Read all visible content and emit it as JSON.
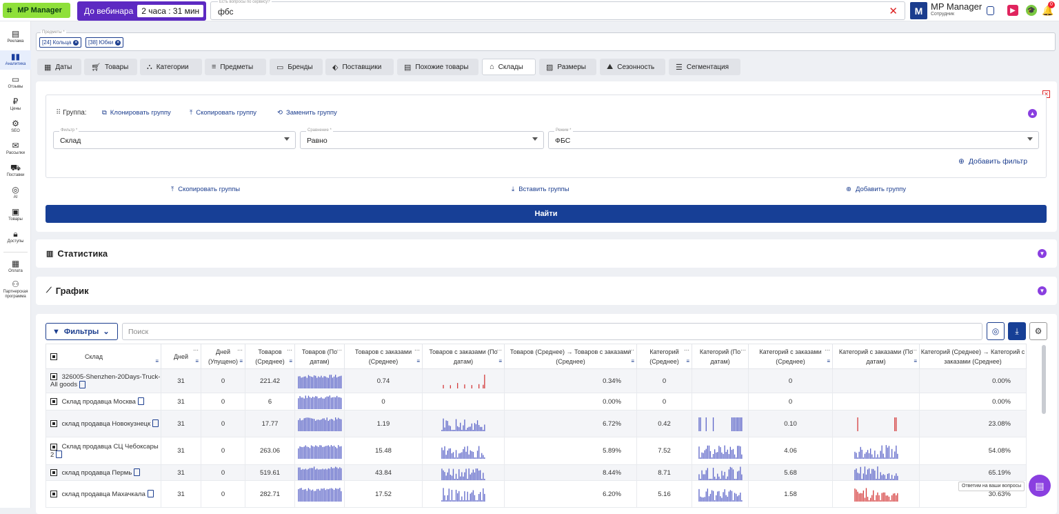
{
  "header": {
    "logo": "MP Manager",
    "webinar_label": "До вебинара",
    "webinar_timer": "2 часа : 31 мин",
    "search_label": "Есть вопросы по сервису?",
    "search_value": "фбс",
    "avatar_letter": "M",
    "user_name": "MP Manager",
    "user_role": "Сотрудник",
    "notif_count": "0"
  },
  "sidebar": [
    {
      "label": "Реклама",
      "icon": "ad-icon"
    },
    {
      "label": "Аналитика",
      "icon": "chart-icon"
    },
    {
      "label": "Отзывы",
      "icon": "chat-icon"
    },
    {
      "label": "Цены",
      "icon": "ruble-icon"
    },
    {
      "label": "SEO",
      "icon": "seo-icon"
    },
    {
      "label": "Рассылки",
      "icon": "mail-icon"
    },
    {
      "label": "Поставки",
      "icon": "truck-icon"
    },
    {
      "label": "AI",
      "icon": "ai-icon"
    },
    {
      "label": "Товары",
      "icon": "box-icon"
    },
    {
      "label": "Доступы",
      "icon": "lock-icon"
    },
    {
      "label": "Оплата",
      "icon": "wallet-icon"
    },
    {
      "label": "Партнерская программа",
      "icon": "partners-icon"
    }
  ],
  "predmety": {
    "label": "Предметы *",
    "chips": [
      "[24] Кольца",
      "[38] Юбки"
    ]
  },
  "tabs": [
    "Даты",
    "Товары",
    "Категории",
    "Предметы",
    "Бренды",
    "Поставщики",
    "Похожие товары",
    "Склады",
    "Размеры",
    "Сезонность",
    "Сегментация"
  ],
  "active_tab": "Склады",
  "filter": {
    "group_label": "Группа:",
    "clone": "Клонировать группу",
    "copy": "Скопировать группу",
    "replace": "Заменить группу",
    "f1_label": "Фильтр *",
    "f1_value": "Склад",
    "f2_label": "Сравнение *",
    "f2_value": "Равно",
    "f3_label": "Режим *",
    "f3_value": "ФБС",
    "add_filter": "Добавить фильтр",
    "copy_groups": "Скопировать группы",
    "paste_groups": "Вставить группы",
    "add_group": "Добавить группу",
    "find": "Найти"
  },
  "sections": {
    "stats": "Статистика",
    "chart": "График"
  },
  "toolbar": {
    "filters": "Фильтры",
    "search_placeholder": "Поиск"
  },
  "table": {
    "headers": [
      "Склад",
      "Дней",
      "Дней (Упущено)",
      "Товаров (Среднее)",
      "Товаров (По датам)",
      "Товаров с заказами (Среднее)",
      "Товаров с заказами (По датам)",
      "Товаров (Среднее) → Товаров с заказами (Среднее)",
      "Категорий (Среднее)",
      "Категорий (По датам)",
      "Категорий с заказами (Среднее)",
      "Категорий с заказами (По датам)",
      "Категорий (Среднее) → Категорий с заказами (Среднее)"
    ],
    "rows": [
      {
        "name": "326005-Shenzhen-20Days-Truck-All goods",
        "days": "31",
        "lost": "0",
        "avg": "221.42",
        "ord_avg": "0.74",
        "conv": "0.34%",
        "cat_avg": "0",
        "cat_ord": "0",
        "cat_conv": "0.00%"
      },
      {
        "name": "Склад продавца Москва",
        "days": "31",
        "lost": "0",
        "avg": "6",
        "ord_avg": "0",
        "conv": "0.00%",
        "cat_avg": "0",
        "cat_ord": "0",
        "cat_conv": "0.00%"
      },
      {
        "name": "склад продавца Новокузнецк",
        "days": "31",
        "lost": "0",
        "avg": "17.77",
        "ord_avg": "1.19",
        "conv": "6.72%",
        "cat_avg": "0.42",
        "cat_ord": "0.10",
        "cat_conv": "23.08%"
      },
      {
        "name": "Склад продавца СЦ Чебоксары 2",
        "days": "31",
        "lost": "0",
        "avg": "263.06",
        "ord_avg": "15.48",
        "conv": "5.89%",
        "cat_avg": "7.52",
        "cat_ord": "4.06",
        "cat_conv": "54.08%"
      },
      {
        "name": "склад продавца Пермь",
        "days": "31",
        "lost": "0",
        "avg": "519.61",
        "ord_avg": "43.84",
        "conv": "8.44%",
        "cat_avg": "8.71",
        "cat_ord": "5.68",
        "cat_conv": "65.19%"
      },
      {
        "name": "склад продавца Махачкала",
        "days": "31",
        "lost": "0",
        "avg": "282.71",
        "ord_avg": "17.52",
        "conv": "6.20%",
        "cat_avg": "5.16",
        "cat_ord": "1.58",
        "cat_conv": "30.63%"
      }
    ]
  },
  "chat": {
    "tooltip": "Ответим на ваши вопросы"
  },
  "colors": {
    "accent": "#1b3d8e",
    "purple": "#8a3fe0",
    "spark_blue": "#5b64c8",
    "spark_red": "#d43a3a",
    "logo_green": "#8fe03a"
  }
}
